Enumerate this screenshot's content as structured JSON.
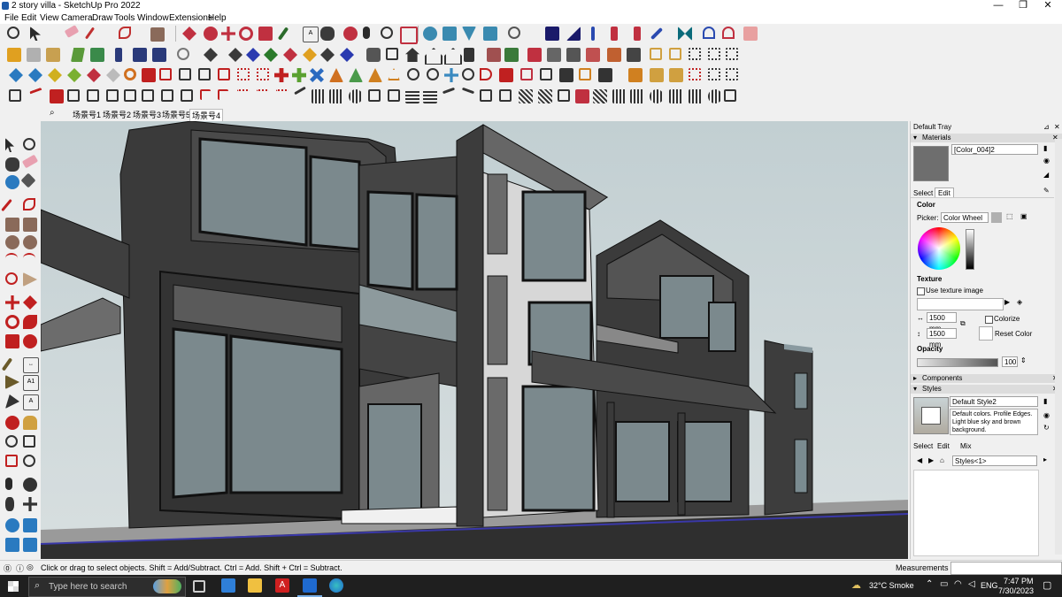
{
  "window": {
    "title": "2 story villa - SketchUp Pro 2022",
    "minimize": "—",
    "maximize": "❐",
    "close": "✕"
  },
  "menu": [
    "File",
    "Edit",
    "View",
    "Camera",
    "Draw",
    "Tools",
    "Window",
    "Extensions",
    "Help"
  ],
  "scenes": [
    "场景号1",
    "场景号2",
    "场景号3",
    "场景号5",
    "场景号4"
  ],
  "active_scene_index": 4,
  "tray": {
    "title": "Default Tray",
    "materials": {
      "header": "Materials",
      "material_name": "[Color_004]2",
      "tab_select": "Select",
      "tab_edit": "Edit",
      "color_label": "Color",
      "picker_label": "Picker:",
      "picker_value": "Color Wheel",
      "texture_label": "Texture",
      "use_texture_label": "Use texture image",
      "width_value": "1500 mm",
      "height_value": "1500 mm",
      "colorize_label": "Colorize",
      "reset_color_label": "Reset Color",
      "opacity_label": "Opacity",
      "opacity_value": "100",
      "swatch_color": "#6e6e6e"
    },
    "components": {
      "header": "Components"
    },
    "styles": {
      "header": "Styles",
      "style_name": "Default Style2",
      "style_desc": "Default colors. Profile Edges. Light blue sky and brown background.",
      "tab_select": "Select",
      "tab_edit": "Edit",
      "tab_mix": "Mix",
      "collection": "Styles<1>"
    }
  },
  "status": {
    "hint": "Click or drag to select objects. Shift = Add/Subtract. Ctrl = Add. Shift + Ctrl = Subtract.",
    "measurements_label": "Measurements"
  },
  "taskbar": {
    "search_placeholder": "Type here to search",
    "weather": "32°C  Smoke",
    "language": "ENG",
    "time": "7:47 PM",
    "date": "7/30/2023"
  },
  "colors": {
    "sky": "#c9d3d5",
    "building_dark": "#3c3c3c",
    "building_light": "#d9d9d9",
    "glass": "#8a979b"
  }
}
